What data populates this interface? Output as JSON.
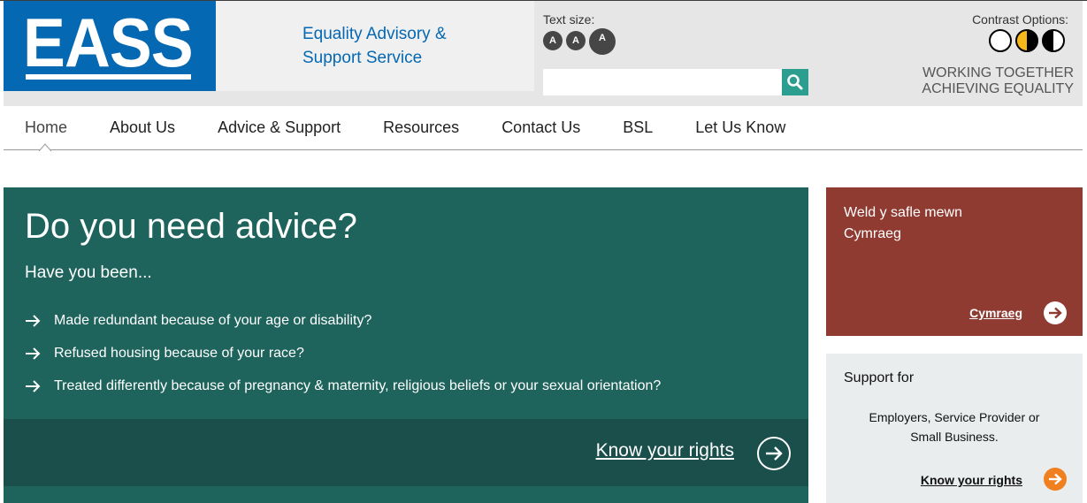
{
  "header": {
    "logo_text": "EASS",
    "tagline_line1": "Equality Advisory &",
    "tagline_line2": "Support Service",
    "text_size_label": "Text size:",
    "text_size_buttons": [
      "A",
      "A",
      "A"
    ],
    "search": {
      "placeholder": "",
      "value": "",
      "icon": "search-icon"
    },
    "contrast_label": "Contrast Options:",
    "contrast_options": [
      "default",
      "yellow-black",
      "black-white"
    ],
    "motto_line1": "WORKING TOGETHER",
    "motto_line2": "ACHIEVING EQUALITY"
  },
  "nav": {
    "items": [
      {
        "label": "Home",
        "active": true
      },
      {
        "label": "About Us"
      },
      {
        "label": "Advice & Support"
      },
      {
        "label": "Resources"
      },
      {
        "label": "Contact Us"
      },
      {
        "label": "BSL"
      },
      {
        "label": "Let Us Know"
      }
    ]
  },
  "hero": {
    "title": "Do you need advice?",
    "subtitle": "Have you been...",
    "items": [
      "Made redundant because of your age or disability?",
      "Refused housing because of your race?",
      "Treated differently because of pregnancy & maternity, religious beliefs or your sexual orientation?"
    ],
    "link_label": "Know your rights"
  },
  "welsh": {
    "line1": "Weld y safle mewn",
    "line2": "Cymraeg",
    "link_label": "Cymraeg"
  },
  "support": {
    "title": "Support for",
    "body_line1": "Employers, Service Provider or",
    "body_line2": "Small Business.",
    "link_label": "Know your rights"
  },
  "colors": {
    "brand_blue": "#0568b2",
    "hero_green": "#1e645c",
    "hero_footer": "#1a4f4c",
    "welsh_red": "#8f3b31",
    "search_teal": "#2b9e8f",
    "accent_orange": "#f07f1f",
    "contrast_yellow": "#f6b81a"
  }
}
